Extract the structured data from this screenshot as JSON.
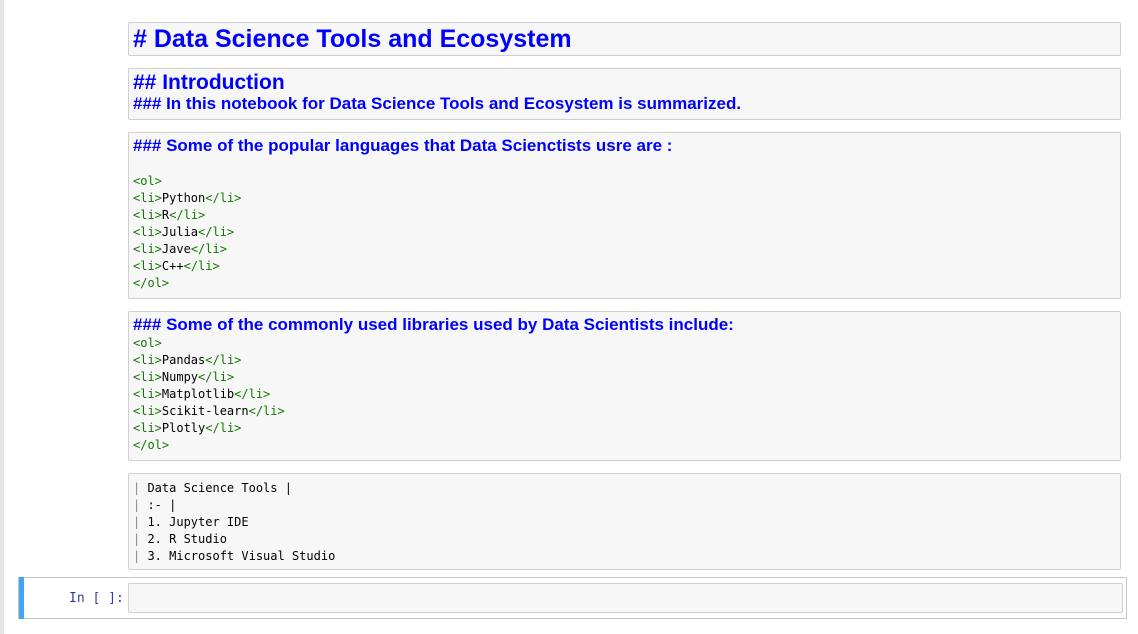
{
  "cells": {
    "title": "# Data Science Tools and Ecosystem",
    "intro_heading": "## Introduction",
    "intro_sub": "### In this notebook for Data Science Tools and Ecosystem is summarized.",
    "languages_heading": "### Some of the popular languages that Data Scienctists usre are :",
    "languages": [
      "Python",
      "R",
      "Julia",
      "Jave",
      "C++"
    ],
    "libraries_heading": "### Some of the commonly used libraries used by Data Scientists include:",
    "libraries": [
      "Pandas",
      "Numpy",
      "Matplotlib",
      "Scikit-learn",
      "Plotly"
    ],
    "table_lines": [
      "Data Science Tools |",
      ":- |",
      "1. Jupyter IDE",
      "2. R Studio",
      "3. Microsoft Visual Studio"
    ]
  },
  "tags": {
    "ol_open": "<ol>",
    "ol_close": "</ol>",
    "li_open": "<li>",
    "li_close": "</li>",
    "pipe": "| "
  },
  "input_cell": {
    "prompt": "In [ ]:"
  },
  "colors": {
    "heading": "#0000ff",
    "tag": "#117700",
    "prompt": "#303f9f",
    "selected_accent": "#42a5f5"
  }
}
